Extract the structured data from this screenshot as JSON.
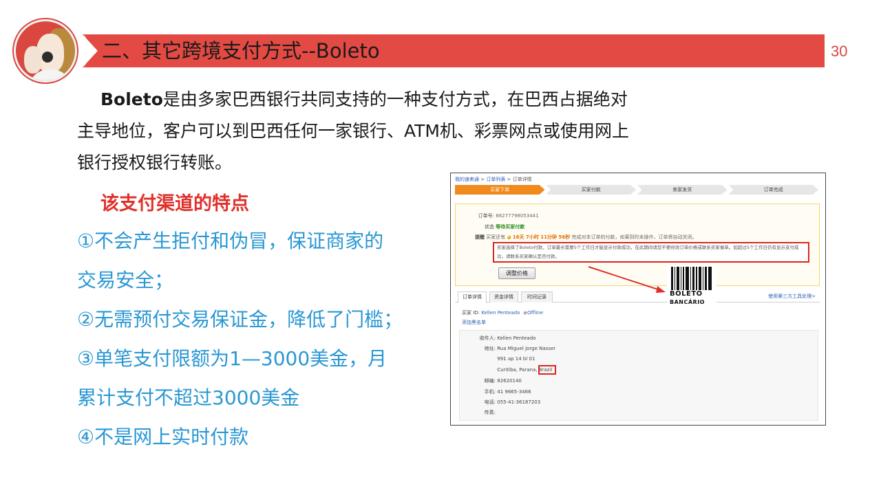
{
  "header": {
    "title": "二、其它跨境支付方式--Boleto",
    "page_number": "30",
    "banner_color": "#e34a43",
    "logo_icon": "customer-service-avatar"
  },
  "intro": {
    "bold_term": "Boleto",
    "line1_rest": "是由多家巴西银行共同支持的一种支付方式，在巴西占据绝对",
    "line2": "主导地位，客户可以到巴西任何一家银行、ATM机、彩票网点或使用网上",
    "line3": "银行授权银行转账。"
  },
  "features": {
    "heading": "该支付渠道的特点",
    "lines": [
      "①不会产生拒付和伪冒，保证商家的",
      "交易安全；",
      "②无需预付交易保证金，降低了门槛；",
      "③单笔支付限额为1—3000美金，月",
      "累计支付不超过3000美金",
      "④不是网上实时付款"
    ],
    "text_color": "#2a97d3",
    "heading_color": "#e0302a"
  },
  "screenshot": {
    "breadcrumb": [
      "我的速卖通",
      "订单列表",
      "订单详情"
    ],
    "steps": [
      "买家下单",
      "买家付款",
      "卖家发货",
      "订单完成"
    ],
    "order_no_label": "订单号:",
    "order_no": "66277798053441",
    "status_label": "状态",
    "status": "等待买家付款",
    "reminder_label": "提醒",
    "reminder_prefix": "买家还有",
    "countdown": "16天 7小时 11分钟 56秒",
    "reminder_suffix": "完成对本订单的付款，如果到时未操作，订单将自动关闭。",
    "notice_line1": "买家选择了Boleto付款，订单最长需要5个工作日才能显示付款成功，在此期间请您不要修改订单价格或联系买家催单。如超过5个工作日仍有显示支付成",
    "notice_line2": "功，请联系买家确认是否付款。",
    "adjust_price_button": "调整价格",
    "tabs": [
      "订单详情",
      "资金详情",
      "时间记录"
    ],
    "third_party_link": "使用第三方工具处理>",
    "buyer_label": "买家 ID:",
    "buyer_name": "Kellen Penteado",
    "online_status": "Offline",
    "add_blacklist": "添加黑名单",
    "address": [
      {
        "label": "收件人:",
        "value": "Kellen Penteado"
      },
      {
        "label": "地址:",
        "value": "Rua Miguel Jorge Nasser"
      },
      {
        "label": "",
        "value": "991 ap 14 bl 01"
      },
      {
        "label": "",
        "value": "Curitiba, Parana, Brazil"
      },
      {
        "label": "邮编:",
        "value": "82620140"
      },
      {
        "label": "手机:",
        "value": "41 9665-3466"
      },
      {
        "label": "电话:",
        "value": "055-41-36187203"
      },
      {
        "label": "传真:",
        "value": ""
      }
    ],
    "boleto_logo_line1": "BOLETO",
    "boleto_logo_line2": "BANCÁRIO"
  }
}
